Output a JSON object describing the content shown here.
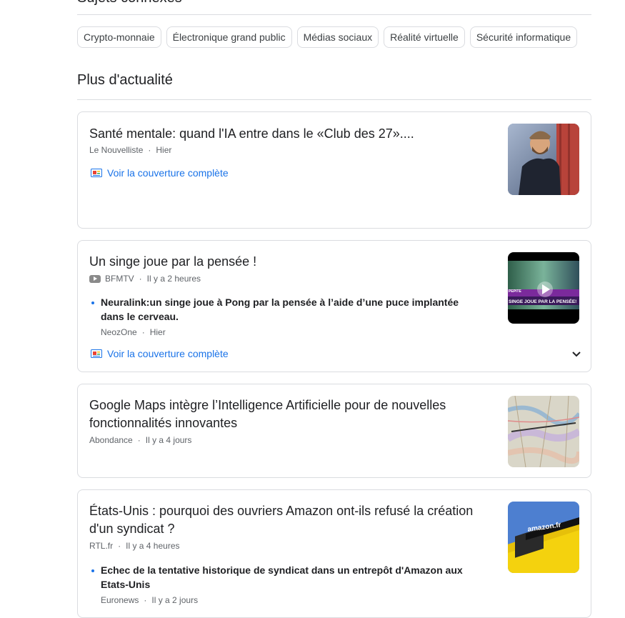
{
  "top_section": {
    "title": "Sujets connexes",
    "chips": [
      "Crypto-monnaie",
      "Électronique grand public",
      "Médias sociaux",
      "Réalité virtuelle",
      "Sécurité informatique"
    ]
  },
  "more_news": {
    "title": "Plus d'actualité",
    "coverage_label": "Voir la couverture complète",
    "articles": [
      {
        "title": "Santé mentale: quand l'IA entre dans le «Club des 27»....",
        "source": "Le Nouvelliste",
        "time": "Hier"
      },
      {
        "title": "Un singe joue par la pensée !",
        "source": "BFMTV",
        "time": "Il y a 2 heures",
        "thumb_caption_1": "SINGE JOUE PAR LA PENSÉE!",
        "thumb_caption_2": "PEPITE",
        "related": {
          "title": "Neuralink:un singe joue à Pong par la pensée à l’aide d’une puce implantée dans le cerveau.",
          "source": "NeozOne",
          "time": "Hier"
        }
      },
      {
        "title": "Google Maps intègre l’Intelligence Artificielle pour de nouvelles fonctionnalités innovantes",
        "source": "Abondance",
        "time": "Il y a 4 jours"
      },
      {
        "title": "États-Unis : pourquoi des ouvriers Amazon ont-ils refusé la création d'un syndicat ?",
        "source": "RTL.fr",
        "time": "Il y a 4 heures",
        "thumb_caption_1": "amazon.fr",
        "related": {
          "title": "Echec de la tentative historique de syndicat dans un entrepôt d'Amazon aux Etats-Unis",
          "source": "Euronews",
          "time": "Il y a 2 jours"
        }
      }
    ]
  },
  "colors": {
    "link": "#1a73e8",
    "border": "#dadce0",
    "meta": "#5f6368"
  }
}
